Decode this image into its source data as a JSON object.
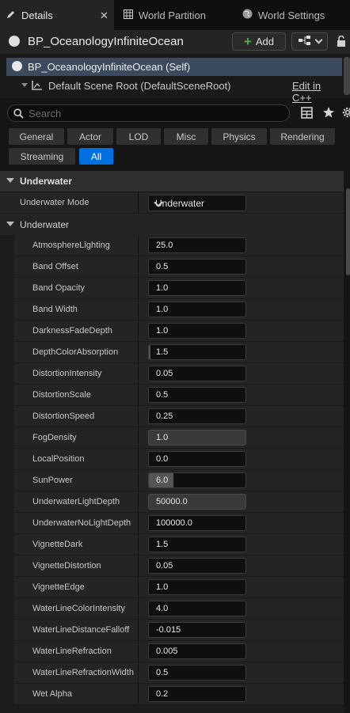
{
  "tabs": [
    {
      "label": "Details",
      "icon": "pencil-icon"
    },
    {
      "label": "World Partition",
      "icon": "grid-map-icon"
    },
    {
      "label": "World Settings",
      "icon": "globe-icon"
    }
  ],
  "tab_close": "✕",
  "actor": {
    "name": "BP_OceanologyInfiniteOcean",
    "add_label": "Add"
  },
  "components": {
    "self": "BP_OceanologyInfiniteOcean (Self)",
    "root": "Default Scene Root (DefaultSceneRoot)",
    "edit_link": "Edit in C++"
  },
  "search": {
    "placeholder": "Search"
  },
  "filters": [
    "General",
    "Actor",
    "LOD",
    "Misc",
    "Physics",
    "Rendering",
    "Streaming",
    "All"
  ],
  "selected_filter": "All",
  "category": "Underwater",
  "underwater_mode": {
    "label": "Underwater Mode",
    "value": "Underwater"
  },
  "subcategory": "Underwater",
  "properties": [
    {
      "name": "AtmosphereLighting",
      "value": "25.0"
    },
    {
      "name": "Band Offset",
      "value": "0.5"
    },
    {
      "name": "Band Opacity",
      "value": "1.0"
    },
    {
      "name": "Band Width",
      "value": "1.0"
    },
    {
      "name": "DarknessFadeDepth",
      "value": "1.0"
    },
    {
      "name": "DepthColorAbsorption",
      "value": "1.5"
    },
    {
      "name": "DistortionIntensity",
      "value": "0.05"
    },
    {
      "name": "DistortionScale",
      "value": "0.5"
    },
    {
      "name": "DistortionSpeed",
      "value": "0.25"
    },
    {
      "name": "FogDensity",
      "value": "1.0"
    },
    {
      "name": "LocalPosition",
      "value": "0.0"
    },
    {
      "name": "SunPower",
      "value": "6.0"
    },
    {
      "name": "UnderwaterLightDepth",
      "value": "50000.0"
    },
    {
      "name": "UnderwaterNoLightDepth",
      "value": "100000.0"
    },
    {
      "name": "VignetteDark",
      "value": "1.5"
    },
    {
      "name": "VignetteDistortion",
      "value": "0.05"
    },
    {
      "name": "VignetteEdge",
      "value": "1.0"
    },
    {
      "name": "WaterLineColorIntensity",
      "value": "4.0"
    },
    {
      "name": "WaterLineDistanceFalloff",
      "value": "-0.015"
    },
    {
      "name": "WaterLineRefraction",
      "value": "0.005"
    },
    {
      "name": "WaterLineRefractionWidth",
      "value": "0.5"
    },
    {
      "name": "Wet Alpha",
      "value": "0.2"
    }
  ],
  "slider_fill": {
    "DepthColorAbsorption": 0.02,
    "FogDensity": 1.0,
    "SunPower": 0.25,
    "UnderwaterLightDepth": 1.0
  }
}
